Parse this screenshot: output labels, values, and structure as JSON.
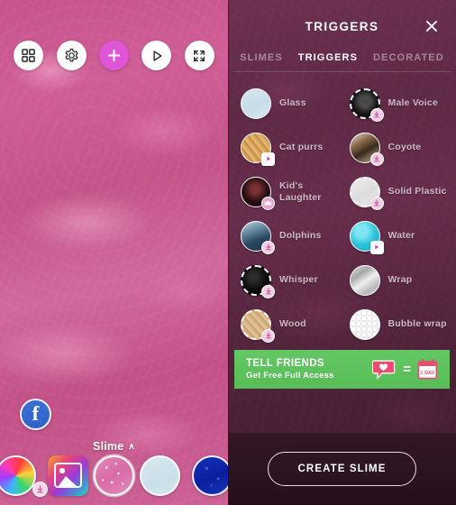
{
  "left": {
    "toolbar": [
      {
        "name": "grid-icon",
        "label": "Grid"
      },
      {
        "name": "gear-icon",
        "label": "Settings"
      },
      {
        "name": "plus-icon",
        "label": "Add"
      },
      {
        "name": "play-icon",
        "label": "Play"
      },
      {
        "name": "fullscreen-icon",
        "label": "Fullscreen"
      }
    ],
    "facebook_label": "f",
    "slime_label": "Slime",
    "slime_chevron": "∧",
    "swatches": [
      {
        "name": "rainbow-slime",
        "style": "sw-rainbow",
        "badge": "download"
      },
      {
        "name": "gallery-picker",
        "style": "sw-gallery",
        "badge": ""
      },
      {
        "name": "pink-glitter-slime",
        "style": "sw-pinkglitter",
        "badge": "",
        "selected": true
      },
      {
        "name": "light-blue-slime",
        "style": "sw-lightblue",
        "badge": ""
      },
      {
        "name": "dark-blue-slime",
        "style": "sw-darkblue",
        "badge": ""
      }
    ]
  },
  "right": {
    "title": "TRIGGERS",
    "close_label": "✕",
    "tabs": [
      {
        "label": "SLIMES",
        "active": false
      },
      {
        "label": "TRIGGERS",
        "active": true
      },
      {
        "label": "DECORATED",
        "active": false
      }
    ],
    "triggers": [
      {
        "label": "Glass",
        "art": "t-glass",
        "badge": "none",
        "dashed": false
      },
      {
        "label": "Male Voice",
        "art": "t-mic",
        "badge": "download",
        "dashed": true
      },
      {
        "label": "Cat purrs",
        "art": "t-catpurrs",
        "badge": "play",
        "dashed": false
      },
      {
        "label": "Coyote",
        "art": "t-coyote",
        "badge": "download",
        "dashed": false
      },
      {
        "label": "Kid's Laughter",
        "art": "t-kids",
        "badge": "crown",
        "dashed": false
      },
      {
        "label": "Solid Plastic",
        "art": "t-solidplastic",
        "badge": "download",
        "dashed": true
      },
      {
        "label": "Dolphins",
        "art": "t-dolphins",
        "badge": "download",
        "dashed": false
      },
      {
        "label": "Water",
        "art": "t-water",
        "badge": "play",
        "dashed": false
      },
      {
        "label": "Whisper",
        "art": "t-whisper",
        "badge": "download",
        "dashed": true
      },
      {
        "label": "Wrap",
        "art": "t-wrap",
        "badge": "none",
        "dashed": false
      },
      {
        "label": "Wood",
        "art": "t-wood",
        "badge": "download",
        "dashed": true
      },
      {
        "label": "Bubble wrap",
        "art": "t-bubblewrap",
        "badge": "none",
        "dashed": false
      }
    ],
    "promo": {
      "title": "TELL FRIENDS",
      "subtitle": "Get Free Full Access",
      "equals": "=",
      "calendar_text": "1 DAY"
    },
    "create_button": "CREATE SLIME"
  },
  "colors": {
    "accent_magenta": "#e055d8",
    "panel_bg": "#5f2a47",
    "slime_pink": "#c7548d",
    "promo_green": "#63c763",
    "badge_pink": "#f0cfe2",
    "facebook_blue": "#3b6fd4"
  }
}
